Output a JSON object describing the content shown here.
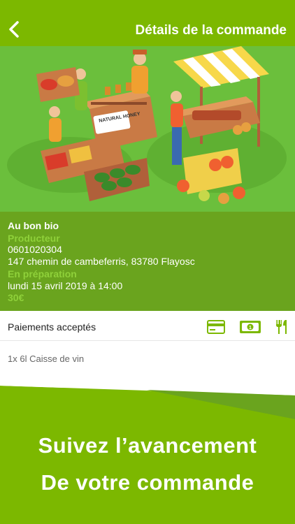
{
  "header": {
    "title": "Détails de la commande",
    "back_icon": "chevron-left-icon"
  },
  "hero": {
    "sign_text": "NATURAL HONEY"
  },
  "order": {
    "shop_name": "Au bon bio",
    "producer_label": "Producteur",
    "phone": "0601020304",
    "address": "147 chemin de cambeferris, 83780 Flayosc",
    "status_label": "En préparation",
    "date": "lundi 15 avril 2019 à 14:00",
    "price": "30€"
  },
  "payments": {
    "label": "Paiements acceptés",
    "icons": [
      "credit-card-icon",
      "cash-icon",
      "restaurant-voucher-icon"
    ]
  },
  "items": [
    "1x 6l Caisse de vin"
  ],
  "promo": {
    "line1": "Suivez l’avancement",
    "line2": "De votre commande"
  },
  "colors": {
    "brand_green": "#7cb800",
    "info_green": "#6aa41e",
    "label_green": "#8fd13a"
  }
}
